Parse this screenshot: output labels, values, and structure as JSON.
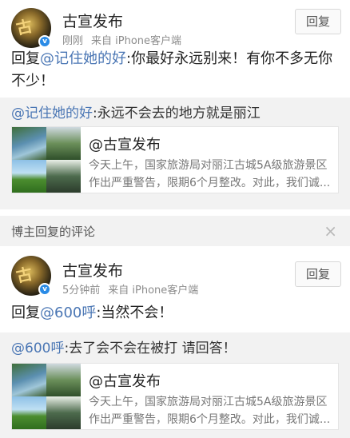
{
  "comments": [
    {
      "username": "古宣发布",
      "time": "刚刚",
      "source": "来自 iPhone客户端",
      "reply_button": "回复",
      "reply_prefix": "回复",
      "reply_mention": "@记住她的好",
      "reply_body": ":你最好永远别来！有你不多无你不少！",
      "quote_mention": "@记住她的好",
      "quote_body": ":永远不会去的地方就是丽江",
      "card_title": "@古宣发布",
      "card_desc": "今天上午，国家旅游局对丽江古城5A级旅游景区作出严重警告，限期6个月整改。对此，我们诚..."
    },
    {
      "username": "古宣发布",
      "time": "5分钟前",
      "source": "来自 iPhone客户端",
      "reply_button": "回复",
      "reply_prefix": "回复",
      "reply_mention": "@600呼",
      "reply_body": ":当然不会！",
      "quote_mention": "@600呼",
      "quote_body": ":去了会不会在被打 请回答！",
      "card_title": "@古宣发布",
      "card_desc": "今天上午，国家旅游局对丽江古城5A级旅游景区作出严重警告，限期6个月整改。对此，我们诚..."
    }
  ],
  "section": {
    "title": "博主回复的评论",
    "close_icon": "×"
  },
  "avatar_glyph": "古",
  "verified_glyph": "v",
  "colors": {
    "mention": "#4a76b4",
    "quote_bg": "#f2f2f2",
    "verified": "#2a8be6"
  }
}
